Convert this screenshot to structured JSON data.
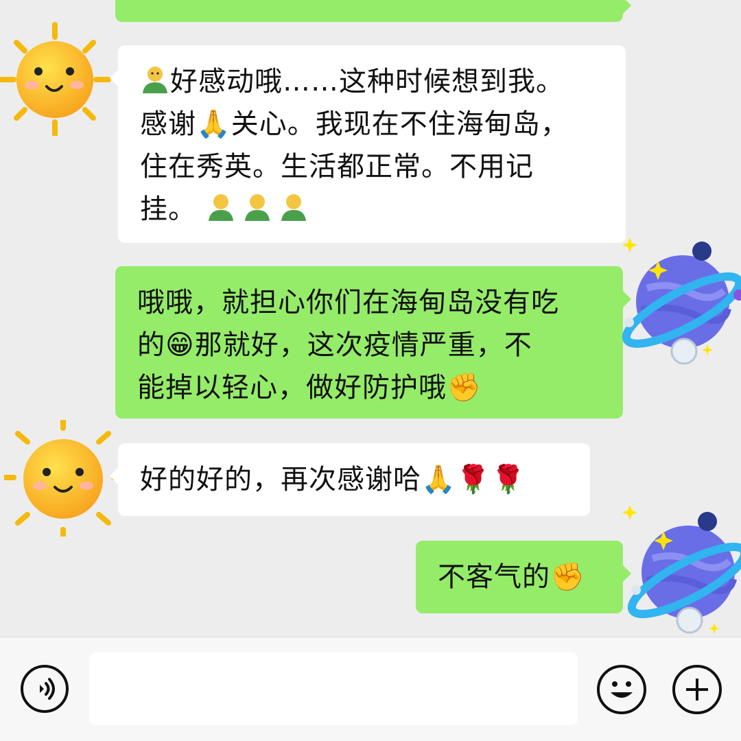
{
  "messages": [
    {
      "side": "right",
      "partial": true,
      "text": ""
    },
    {
      "side": "left",
      "lines": [
        "好感动哦……这种时候想到我。",
        "感谢🙏关心。我现在不住海甸岛，",
        "住在秀英。生活都正常。不用记",
        "挂。"
      ]
    },
    {
      "side": "right",
      "lines": [
        "哦哦，就担心你们在海甸岛没有吃",
        "的😁那就好，这次疫情严重，不",
        "能掉以轻心，做好防护哦✊"
      ]
    },
    {
      "side": "left",
      "lines": [
        "好的好的，再次感谢哈🙏🌹🌹"
      ]
    },
    {
      "side": "right",
      "lines": [
        "不客气的✊"
      ]
    }
  ],
  "input": {
    "value": "",
    "placeholder": ""
  },
  "icons": {
    "voice": "voice-icon",
    "emoji": "emoji-icon",
    "plus": "plus-icon",
    "avatar_left": "sun-avatar",
    "avatar_right": "planet-avatar"
  },
  "colors": {
    "background": "#ededed",
    "bubble_sent": "#95ec69",
    "bubble_received": "#ffffff",
    "input_bar": "#f7f7f7"
  }
}
